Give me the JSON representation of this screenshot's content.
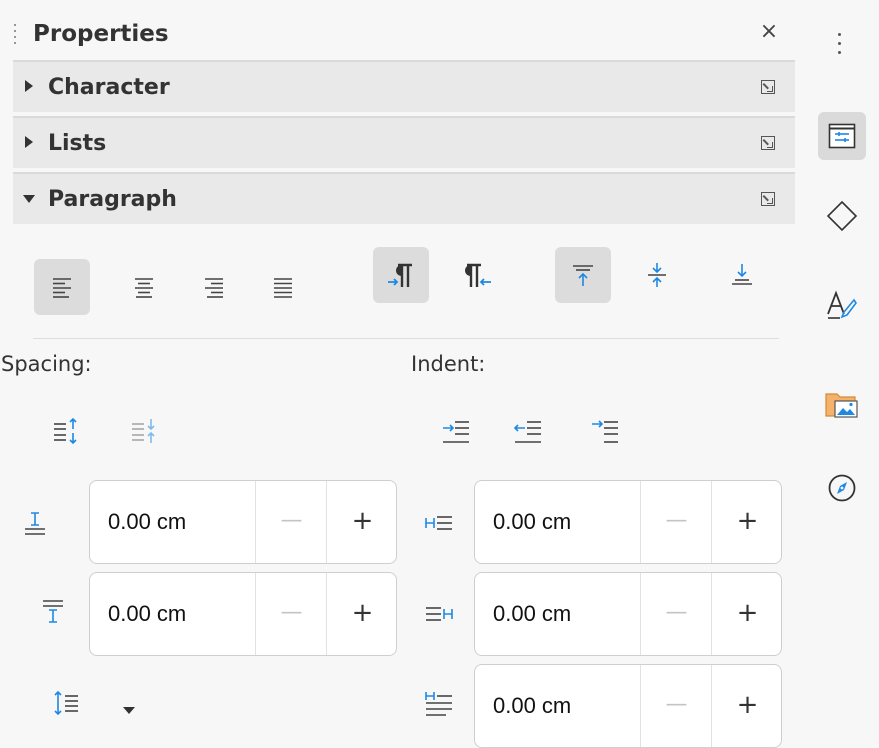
{
  "panel": {
    "title": "Properties",
    "close_glyph": "×",
    "sections": [
      {
        "label": "Character",
        "expanded": false
      },
      {
        "label": "Lists",
        "expanded": false
      },
      {
        "label": "Paragraph",
        "expanded": true
      }
    ]
  },
  "paragraph": {
    "alignment_buttons": [
      "align-left-icon",
      "align-center-icon",
      "align-right-icon",
      "justify-icon"
    ],
    "active_alignment": "align-left-icon",
    "direction_buttons": [
      "ltr-paragraph-icon",
      "rtl-paragraph-icon"
    ],
    "active_direction": "ltr-paragraph-icon",
    "vertical_buttons": [
      "align-top-icon",
      "align-middle-icon",
      "align-bottom-icon"
    ],
    "active_vertical": "align-top-icon",
    "spacing_label": "Spacing:",
    "indent_label": "Indent:",
    "above_spacing": "0.00 cm",
    "below_spacing": "0.00 cm",
    "before_indent": "0.00 cm",
    "after_indent": "0.00 cm",
    "first_line_indent": "0.00 cm",
    "minus_glyph": "—",
    "plus_glyph": "+"
  },
  "colors": {
    "accent_blue": "#1e88e5",
    "active_bg": "#dcdcdc",
    "section_bg": "#e9e9e9"
  },
  "tabbar": {
    "items": [
      "more-options-icon",
      "properties-icon",
      "shapes-icon",
      "styles-icon",
      "gallery-icon",
      "navigator-icon"
    ],
    "active": "properties-icon"
  }
}
